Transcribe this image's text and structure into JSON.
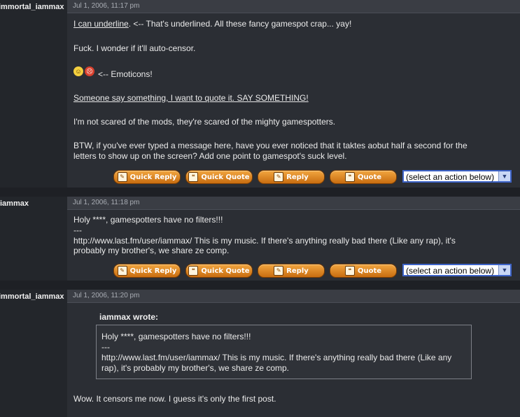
{
  "posts": [
    {
      "author": "immortal_iammax",
      "timestamp": "Jul 1, 2006, 11:17 pm",
      "lines": {
        "l1_underlined": "I can underline",
        "l1_rest": ". <-- That's underlined. All these fancy gamespot crap... yay!",
        "l2": "Fuck. I wonder if it'll auto-censor.",
        "l3": "<-- Emoticons!",
        "l4": "Someone say something, I want to quote it. SAY SOMETHING!",
        "l5": "I'm not scared of the mods, they're scared of the mighty gamespotters.",
        "l6a": "BTW, if you've ever typed a message here, have you ever noticed that it taktes aobut half a second for the",
        "l6b": "letters to show up on the screen? Add one point to gamespot's suck level."
      }
    },
    {
      "author": "iammax",
      "timestamp": "Jul 1, 2006, 11:18 pm",
      "lines": {
        "l1": "Holy ****, gamespotters have no filters!!!",
        "l2": "---",
        "l3": "http://www.last.fm/user/iammax/ This is my music. If there's anything really bad there (Like any rap), it's",
        "l4": "probably my brother's, we share ze comp."
      }
    },
    {
      "author": "immortal_iammax",
      "timestamp": "Jul 1, 2006, 11:20 pm",
      "quote_author": "iammax wrote:",
      "quote_lines": {
        "q1": "Holy ****, gamespotters have no filters!!!",
        "q2": "---",
        "q3": "http://www.last.fm/user/iammax/ This is my music. If there's anything really bad there (Like any",
        "q4": "rap), it's probably my brother's, we share ze comp."
      },
      "reply": "Wow. It censors me now. I guess it's only the first post."
    }
  ],
  "actions": {
    "quick_reply": "Quick Reply",
    "quick_quote": "Quick Quote",
    "reply": "Reply",
    "quote": "Quote",
    "select_action": "(select an action below)"
  },
  "colors": {
    "button_orange": "#e08a22",
    "background": "#2a2d33",
    "select_border": "#3d63c8"
  }
}
